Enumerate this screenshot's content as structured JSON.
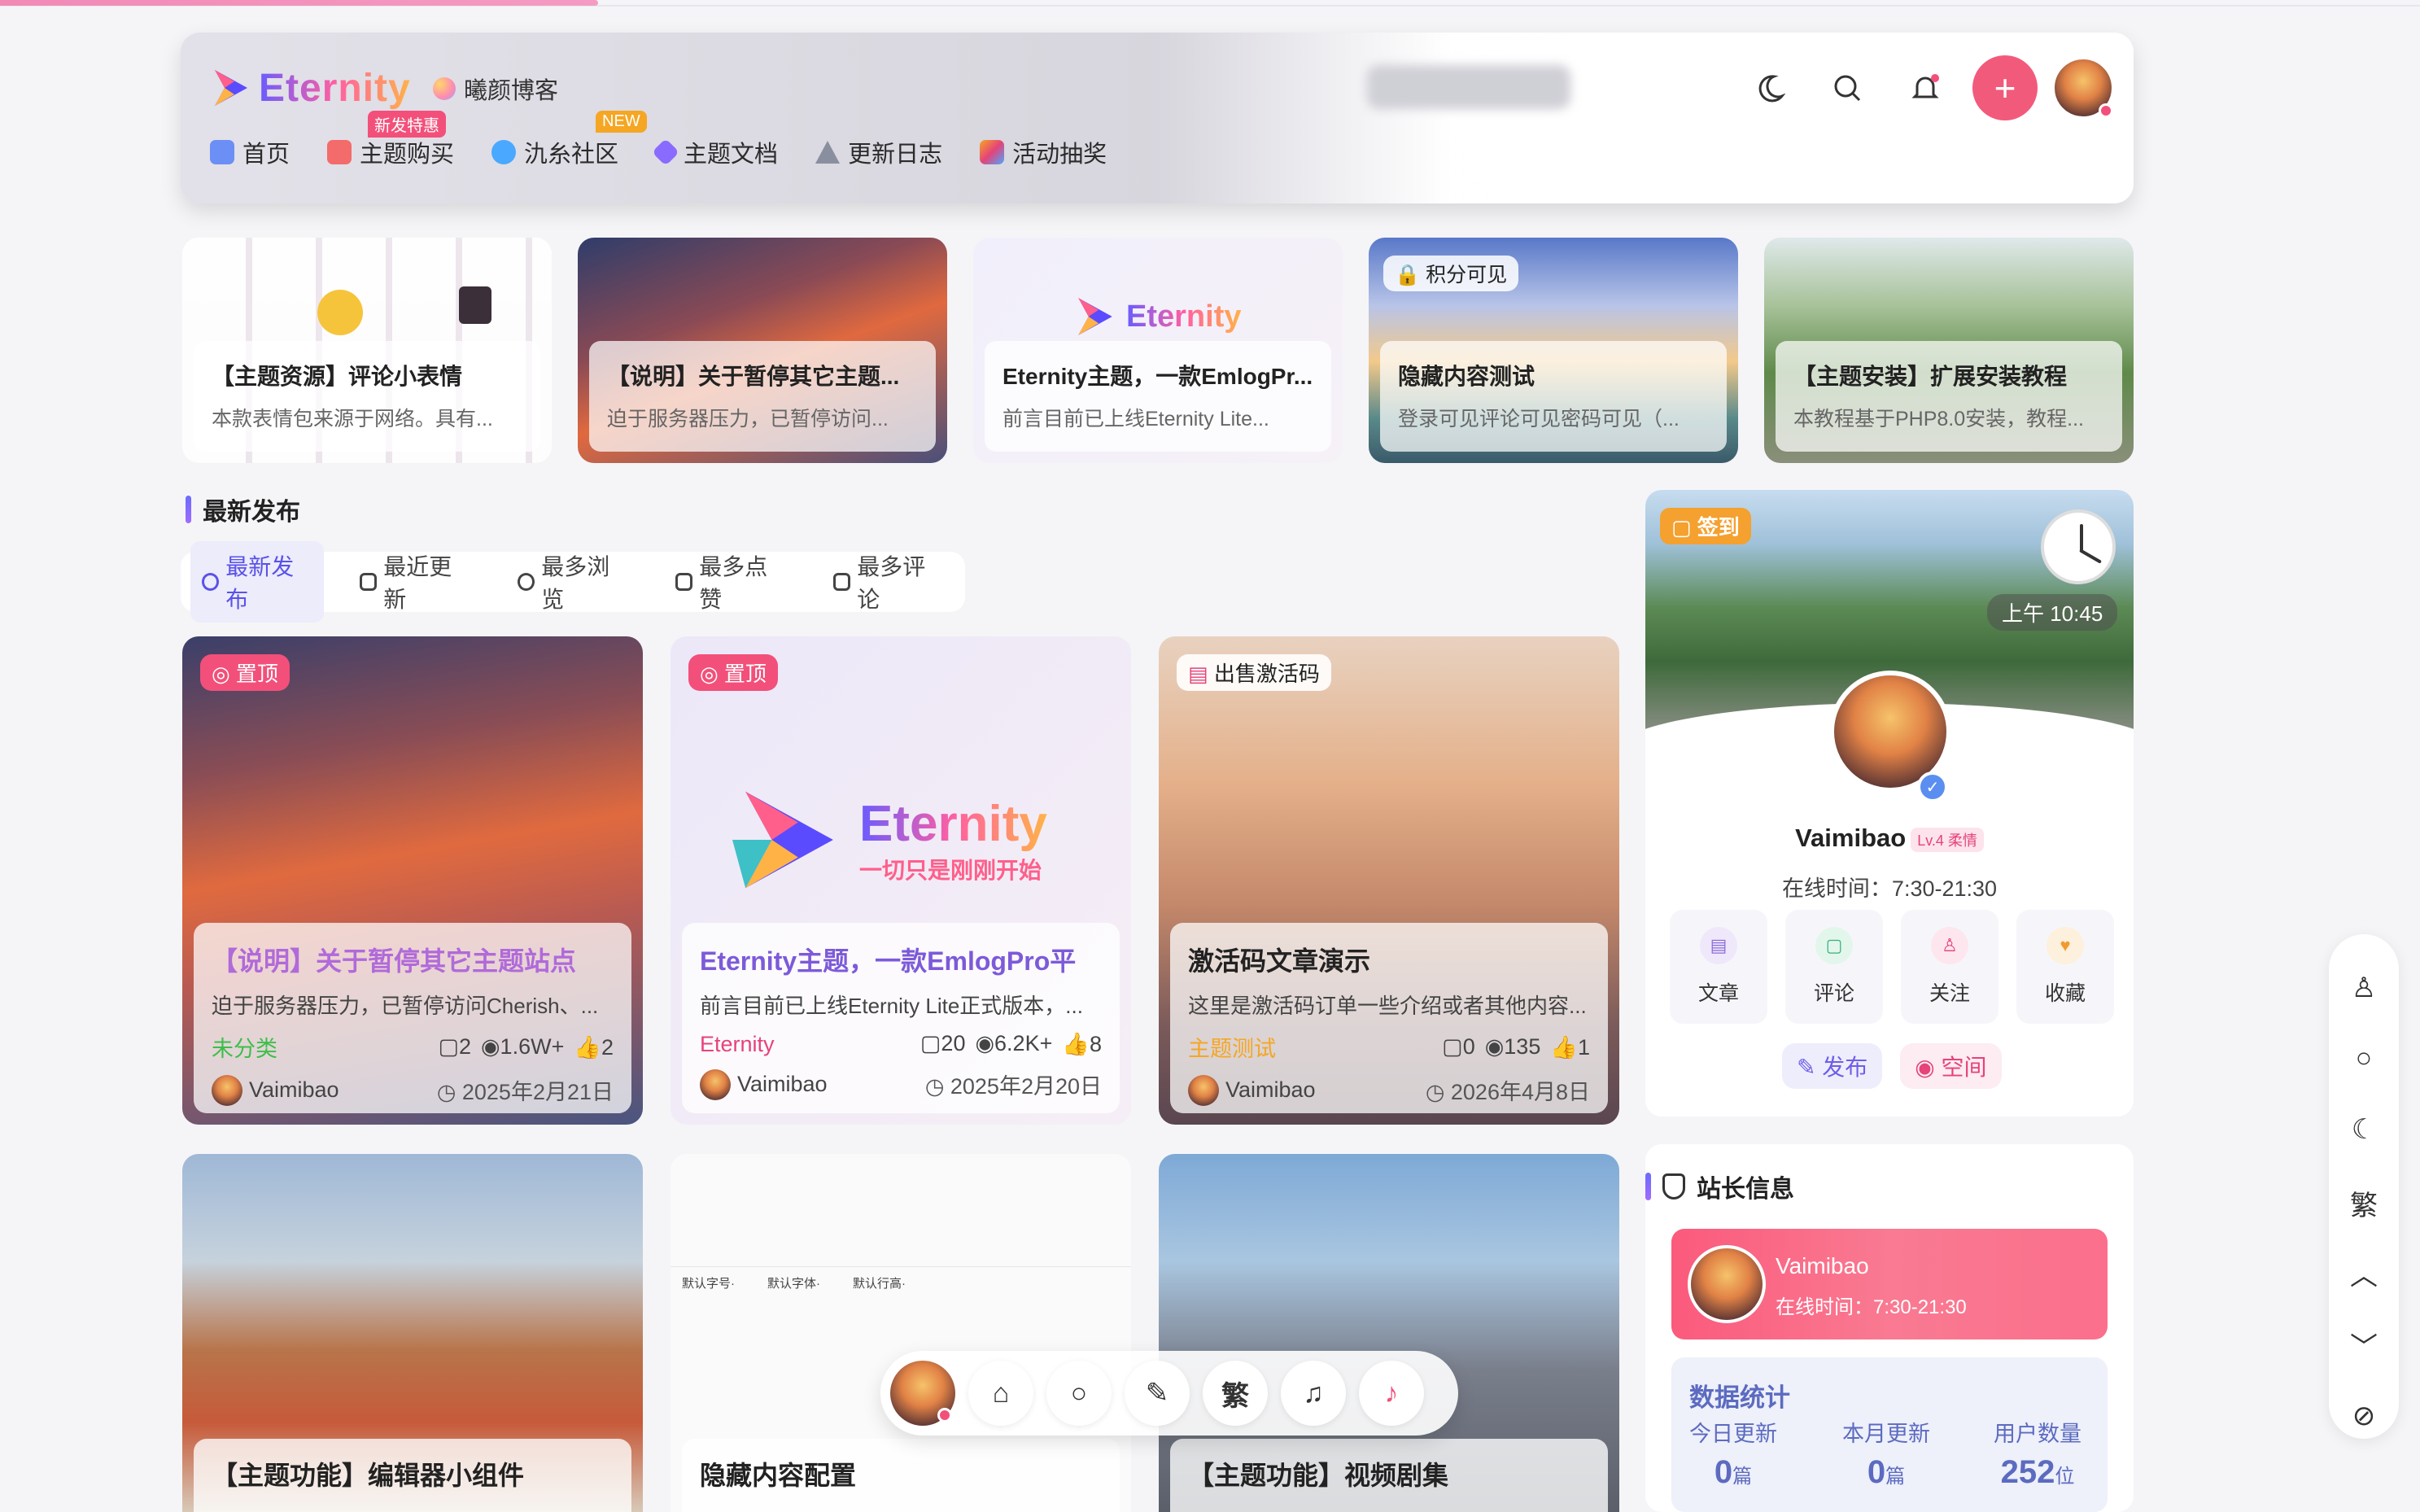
{
  "header": {
    "logo_text": "Eternity",
    "site_name": "曦颜博客",
    "nav": [
      {
        "label": "首页",
        "badge": "",
        "icon": "home-icon",
        "color": "#6b8ff5"
      },
      {
        "label": "主题购买",
        "badge": "新发特惠",
        "icon": "gift-icon",
        "color": "#f36b6b"
      },
      {
        "label": "氿糸社区",
        "badge": "NEW",
        "icon": "chat-icon",
        "color": "#4aa8ff"
      },
      {
        "label": "主题文档",
        "badge": "",
        "icon": "rocket-icon",
        "color": "#8a6bff"
      },
      {
        "label": "更新日志",
        "badge": "",
        "icon": "flask-icon",
        "color": "#8a8fa0"
      },
      {
        "label": "活动抽奖",
        "badge": "",
        "icon": "party-icon",
        "color": "#f5a623"
      }
    ],
    "tools": [
      "moon-icon",
      "search-icon",
      "bell-icon",
      "plus-icon",
      "avatar"
    ]
  },
  "featured": [
    {
      "title": "【主题资源】评论小表情",
      "excerpt": "本款表情包来源于网络。具有...",
      "lock": ""
    },
    {
      "title": "【说明】关于暂停其它主题...",
      "excerpt": "迫于服务器压力，已暂停访问...",
      "lock": ""
    },
    {
      "title": "Eternity主题，一款EmlogPr...",
      "excerpt": "前言目前已上线Eternity Lite...",
      "lock": ""
    },
    {
      "title": "隐藏内容测试",
      "excerpt": "登录可见评论可见密码可见（...",
      "lock": "积分可见"
    },
    {
      "title": "【主题安装】扩展安装教程",
      "excerpt": "本教程基于PHP8.0安装，教程...",
      "lock": ""
    }
  ],
  "featured_logo": "Eternity",
  "section_title": "最新发布",
  "tabs": [
    "最新发布",
    "最近更新",
    "最多浏览",
    "最多点赞",
    "最多评论"
  ],
  "posts": [
    {
      "tag": "置顶",
      "title": "【说明】关于暂停其它主题站点",
      "excerpt": "迫于服务器压力，已暂停访问Cherish、...",
      "category": "未分类",
      "comments": "2",
      "views": "1.6W+",
      "likes": "2",
      "author": "Vaimibao",
      "date": "2025年2月21日"
    },
    {
      "tag": "置顶",
      "title": "Eternity主题，一款EmlogPro平",
      "excerpt": "前言目前已上线Eternity Lite正式版本，...",
      "category": "Eternity",
      "comments": "20",
      "views": "6.2K+",
      "likes": "8",
      "author": "Vaimibao",
      "date": "2025年2月20日"
    },
    {
      "tag": "出售激活码",
      "title": "激活码文章演示",
      "excerpt": "这里是激活码订单一些介绍或者其他内容...",
      "category": "主题测试",
      "comments": "0",
      "views": "135",
      "likes": "1",
      "author": "Vaimibao",
      "date": "2026年4月8日"
    }
  ],
  "post_logo": {
    "main": "Eternity",
    "sub": "一切只是刚刚开始"
  },
  "bottom_posts": [
    {
      "title": "【主题功能】编辑器小组件"
    },
    {
      "title": "隐藏内容配置"
    },
    {
      "title": "【主题功能】视频剧集"
    }
  ],
  "editor_toolbar": [
    "默认字号·",
    "默认字体·",
    "默认行高·"
  ],
  "profile": {
    "checkin": "签到",
    "time": "上午 10:45",
    "name": "Vaimibao",
    "level": "Lv.4",
    "level_title": "柔情",
    "online": "在线时间：7:30-21:30",
    "actions": [
      {
        "label": "文章",
        "icon": "article-icon",
        "color": "#8a6bd9",
        "bg": "#efe8fb"
      },
      {
        "label": "评论",
        "icon": "comment-icon",
        "color": "#34b37a",
        "bg": "#e3f6ec"
      },
      {
        "label": "关注",
        "icon": "follow-icon",
        "color": "#e5437a",
        "bg": "#fde6ee"
      },
      {
        "label": "收藏",
        "icon": "heart-icon",
        "color": "#f29a2e",
        "bg": "#fdf0dd"
      }
    ],
    "publish": "发布",
    "space": "空间"
  },
  "site_info": {
    "title": "站长信息",
    "name": "Vaimibao",
    "online": "在线时间：7:30-21:30",
    "stats_title": "数据统计",
    "stats": [
      {
        "label": "今日更新",
        "value": "0",
        "unit": "篇"
      },
      {
        "label": "本月更新",
        "value": "0",
        "unit": "篇"
      },
      {
        "label": "用户数量",
        "value": "252",
        "unit": "位"
      }
    ]
  },
  "side_tools": [
    "user-icon",
    "search-icon",
    "moon-icon",
    "繁",
    "chevron-up-icon",
    "chevron-down-icon",
    "clock-off-icon"
  ],
  "dock": [
    "avatar",
    "home-icon",
    "search-icon",
    "edit-icon",
    "繁",
    "bell-icon",
    "notification-icon"
  ]
}
